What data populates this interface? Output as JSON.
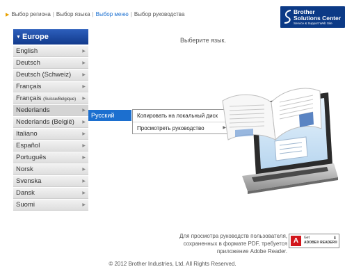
{
  "breadcrumb": {
    "items": [
      "Выбор региона",
      "Выбор языка",
      "Выбор меню",
      "Выбор руководства"
    ]
  },
  "logo": {
    "line1": "Brother",
    "line2": "Solutions Center",
    "line3": "Service & Support Web Site"
  },
  "region": {
    "label": "Europe"
  },
  "languages": [
    {
      "label": "English",
      "sub": ""
    },
    {
      "label": "Deutsch",
      "sub": ""
    },
    {
      "label": "Deutsch (Schweiz)",
      "sub": ""
    },
    {
      "label": "Français",
      "sub": ""
    },
    {
      "label": "Français ",
      "sub": "(Suisse/Belgique)"
    },
    {
      "label": "Nederlands",
      "sub": ""
    },
    {
      "label": "Nederlands (België)",
      "sub": ""
    },
    {
      "label": "Italiano",
      "sub": ""
    },
    {
      "label": "Español",
      "sub": ""
    },
    {
      "label": "Português",
      "sub": ""
    },
    {
      "label": "Norsk",
      "sub": ""
    },
    {
      "label": "Svenska",
      "sub": ""
    },
    {
      "label": "Dansk",
      "sub": ""
    },
    {
      "label": "Suomi",
      "sub": ""
    }
  ],
  "submenu": {
    "selected_language": "Русский",
    "actions": [
      "Копировать на локальный диск",
      "Просмотреть руководство"
    ]
  },
  "main": {
    "prompt": "Выберите язык."
  },
  "adobe": {
    "line1": "Для просмотра руководств пользователя,",
    "line2": "сохраненных в формате PDF, требуется",
    "line3": "приложение Adobe Reader.",
    "badge_get": "Get",
    "badge_reader": "ADOBE® READER®"
  },
  "footer": {
    "copyright": "© 2012 Brother Industries, Ltd. All Rights Reserved."
  },
  "colors": {
    "accent": "#1c6fcf",
    "region_header": "#123a8c",
    "breadcrumb_arrow": "#e8a100"
  }
}
